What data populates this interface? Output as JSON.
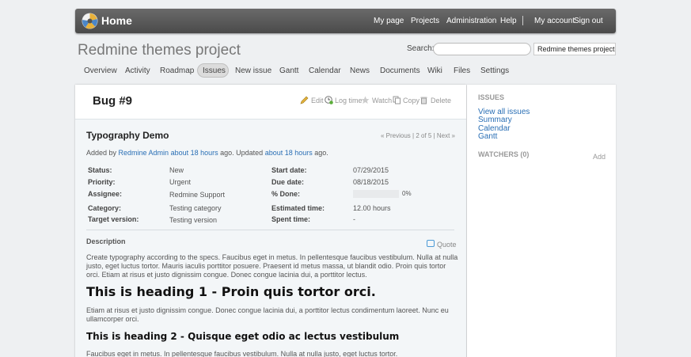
{
  "top_bar": {
    "title": "Home",
    "menu": {
      "my_page": "My page",
      "projects": "Projects",
      "administration": "Administration",
      "help": "Help"
    },
    "account": {
      "my_account": "My account",
      "sign_out": "Sign out"
    }
  },
  "header": {
    "project_title": "Redmine themes project",
    "search_label": "Search:",
    "search_value": "",
    "project_jump": "Redmine themes project"
  },
  "main_menu": [
    "Overview",
    "Activity",
    "Roadmap",
    "Issues",
    "New issue",
    "Gantt",
    "Calendar",
    "News",
    "Documents",
    "Wiki",
    "Files",
    "Settings"
  ],
  "issue": {
    "heading": "Bug #9",
    "actions": {
      "edit": "Edit",
      "log_time": "Log time",
      "watch": "Watch",
      "copy": "Copy",
      "delete": "Delete"
    },
    "subject": "Typography Demo",
    "nav": "« Previous | 2 of 5 | Next »",
    "author_prefix": "Added by ",
    "author": "Redmine Admin",
    "created_ago": "about 18 hours",
    "updated_text": " ago. Updated ",
    "updated_ago": "about 18 hours",
    "suffix": " ago.",
    "attributes": {
      "status_label": "Status:",
      "status": "New",
      "priority_label": "Priority:",
      "priority": "Urgent",
      "assignee_label": "Assignee:",
      "assignee": "Redmine Support",
      "category_label": "Category:",
      "category": "Testing category",
      "target_label": "Target version:",
      "target": "Testing version",
      "start_label": "Start date:",
      "start": "07/29/2015",
      "due_label": "Due date:",
      "due": "08/18/2015",
      "done_label": "% Done:",
      "done": "0%",
      "done_fraction": 0,
      "estimated_label": "Estimated time:",
      "estimated": "12.00 hours",
      "spent_label": "Spent time:",
      "spent": "-"
    },
    "description_label": "Description",
    "quote": "Quote",
    "paragraph1": "Create typography according to the specs. Faucibus eget in metus. In pellentesque faucibus vestibulum. Nulla at nulla justo, eget luctus tortor. Mauris iaculis porttitor posuere. Praesent id metus massa, ut blandit odio. Proin quis tortor orci. Etiam at risus et justo dignissim congue. Donec congue lacinia dui, a porttitor lectus.",
    "heading1": "This is heading 1 - Proin quis tortor orci.",
    "paragraph2": "Etiam at risus et justo dignissim congue. Donec congue lacinia dui, a porttitor lectus condimentum laoreet. Nunc eu ullamcorper orci.",
    "heading2": "This is heading 2 - Quisque eget odio ac lectus vestibulum",
    "paragraph3": "Faucibus eget in metus. In pellentesque faucibus vestibulum. Nulla at nulla justo, eget luctus tortor."
  },
  "sidebar": {
    "issues_heading": "ISSUES",
    "links": [
      "View all issues",
      "Summary",
      "Calendar",
      "Gantt"
    ],
    "watchers_heading": "WATCHERS (0)",
    "add": "Add"
  },
  "colors": {
    "link": "#2a6fb5",
    "topbar": "#555555"
  }
}
